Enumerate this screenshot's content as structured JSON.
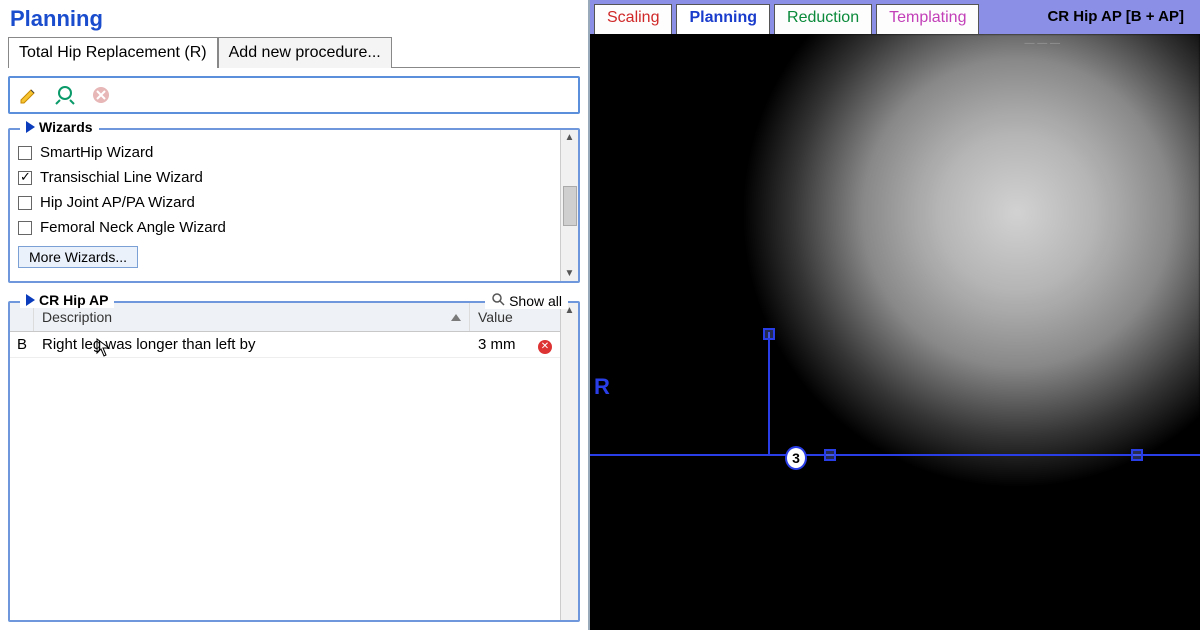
{
  "left": {
    "title": "Planning",
    "procedure_tabs": {
      "active": "Total Hip Replacement (R)",
      "add": "Add new procedure..."
    },
    "toolbar": {
      "edit": "edit-pencil",
      "tool": "calipers",
      "delete": "delete"
    },
    "wizards": {
      "heading": "Wizards",
      "items": [
        {
          "label": "SmartHip Wizard",
          "checked": false
        },
        {
          "label": "Transischial Line Wizard",
          "checked": true
        },
        {
          "label": "Hip Joint AP/PA Wizard",
          "checked": false
        },
        {
          "label": "Femoral Neck Angle Wizard",
          "checked": false
        }
      ],
      "more": "More Wizards..."
    },
    "measurements": {
      "heading": "CR Hip AP",
      "show_all": "Show all",
      "columns": {
        "desc": "Description",
        "value": "Value"
      },
      "rows": [
        {
          "flag": "B",
          "desc": "Right leg was longer than left by",
          "value": "3 mm"
        }
      ]
    }
  },
  "right": {
    "tabs": {
      "scaling": "Scaling",
      "planning": "Planning",
      "reduction": "Reduction",
      "templating": "Templating"
    },
    "image_label": "CR Hip AP  [B + AP]",
    "side_marker": "R",
    "annotation_badge": "3"
  }
}
